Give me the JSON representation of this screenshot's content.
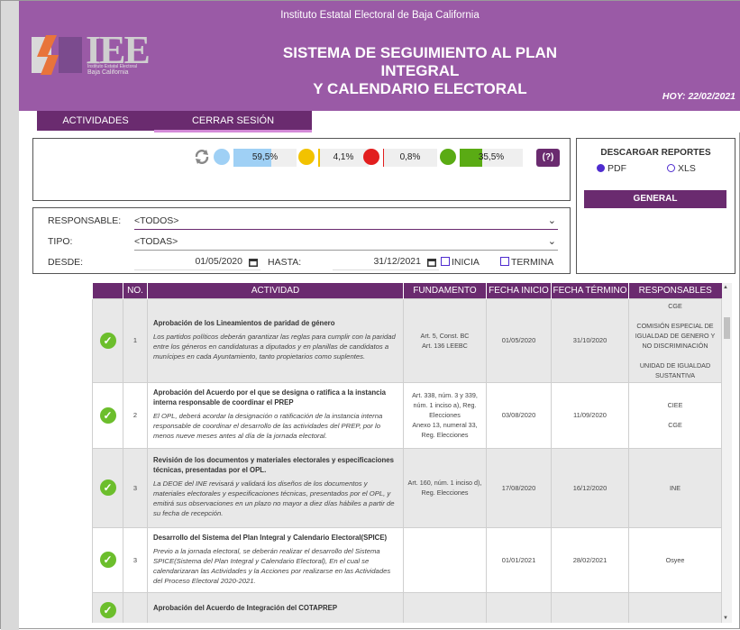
{
  "header": {
    "institution": "Instituto Estatal Electoral de Baja California",
    "title_line1": "SISTEMA DE SEGUIMIENTO AL PLAN INTEGRAL",
    "title_line2": "Y CALENDARIO ELECTORAL",
    "today": "HOY: 22/02/2021",
    "logo_text": "IEE",
    "logo_sub1": "Instituto Estatal Electoral",
    "logo_sub2": "Baja California"
  },
  "nav": {
    "activities": "ACTIVIDADES",
    "logout": "CERRAR SESIÓN"
  },
  "stats": [
    {
      "icon": "blue-clock-icon",
      "label": "59,5%",
      "value": 59.5,
      "color": "#9fd0f5"
    },
    {
      "icon": "yellow-warning-icon",
      "label": "4,1%",
      "value": 4.1,
      "color": "#f2c200"
    },
    {
      "icon": "red-alert-icon",
      "label": "0,8%",
      "value": 0.8,
      "color": "#e21e1e"
    },
    {
      "icon": "green-check-icon",
      "label": "35,5%",
      "value": 35.5,
      "color": "#5aab14"
    }
  ],
  "help_label": "(?)",
  "filters": {
    "responsable_label": "RESPONSABLE:",
    "responsable_value": "<TODOS>",
    "tipo_label": "TIPO:",
    "tipo_value": "<TODAS>",
    "desde_label": "DESDE:",
    "desde_value": "01/05/2020",
    "hasta_label": "HASTA:",
    "hasta_value": "31/12/2021",
    "inicia_label": "INICIA",
    "termina_label": "TERMINA"
  },
  "reports": {
    "title": "DESCARGAR REPORTES",
    "pdf": "PDF",
    "xls": "XLS",
    "general": "GENERAL"
  },
  "table": {
    "headers": [
      "",
      "NO.",
      "ACTIVIDAD",
      "FUNDAMENTO",
      "FECHA INICIO",
      "FECHA TÉRMINO",
      "RESPONSABLES"
    ],
    "rows": [
      {
        "no": "1",
        "title": "Aprobación de los Lineamientos de paridad de género",
        "desc": "Los partidos políticos deberán garantizar las reglas para cumplir con la paridad entre los géneros en candidaturas a diputados y en planillas de candidatos a munícipes en cada Ayuntamiento, tanto propietarios como suplentes.",
        "fund": "Art. 5, Const. BC\nArt. 136 LEEBC",
        "start": "01/05/2020",
        "end": "31/10/2020",
        "resp": "CGE\n\nCOMISIÓN ESPECIAL DE IGUALDAD DE GENERO Y NO DISCRIMINACIÓN\n\nUNIDAD DE IGUALDAD SUSTANTIVA"
      },
      {
        "no": "2",
        "title": "Aprobación del Acuerdo por el que se designa o ratifica a la instancia interna responsable de coordinar el PREP",
        "desc": "El OPL, deberá acordar la designación o ratificación de la instancia interna responsable de coordinar el desarrollo de las actividades del PREP, por lo menos nueve meses antes al día de la jornada electoral.",
        "fund": "Art. 338, núm. 3 y 339, núm. 1 inciso a), Reg. Elecciones\nAnexo 13, numeral 33, Reg. Elecciones",
        "start": "03/08/2020",
        "end": "11/09/2020",
        "resp": "CIEE\n\nCGE"
      },
      {
        "no": "3",
        "title": "Revisión de los documentos y materiales electorales y especificaciones técnicas, presentadas por el OPL.",
        "desc": "La DEOE del INE revisará y validará los diseños de los documentos y materiales electorales y especificaciones técnicas, presentados por el OPL, y emitirá sus observaciones en un plazo no mayor a diez días hábiles a partir de su fecha de recepción.",
        "fund": "Art. 160, núm. 1 inciso d), Reg. Elecciones",
        "start": "17/08/2020",
        "end": "16/12/2020",
        "resp": "INE"
      },
      {
        "no": "3",
        "title": "Desarrollo del Sistema del Plan Integral y Calendario Electoral(SPICE)",
        "desc": "Previo a la jornada electoral, se deberán realizar el desarrollo del Sistema SPICE(Sistema del Plan Integral y Calendario Electoral), En el cual se calendarizaran las Actividades y la Acciones por realizarse en las Actividades del Proceso Electoral 2020-2021.",
        "fund": "",
        "start": "01/01/2021",
        "end": "28/02/2021",
        "resp": "Osyee"
      },
      {
        "no": "",
        "title": "Aprobación del Acuerdo de Integración del COTAPREP",
        "desc": "",
        "fund": "",
        "start": "",
        "end": "",
        "resp": ""
      }
    ]
  },
  "colors": {
    "header_bg": "#9a5aa6",
    "primary": "#6a2b6f",
    "success": "#6cbe2c"
  }
}
